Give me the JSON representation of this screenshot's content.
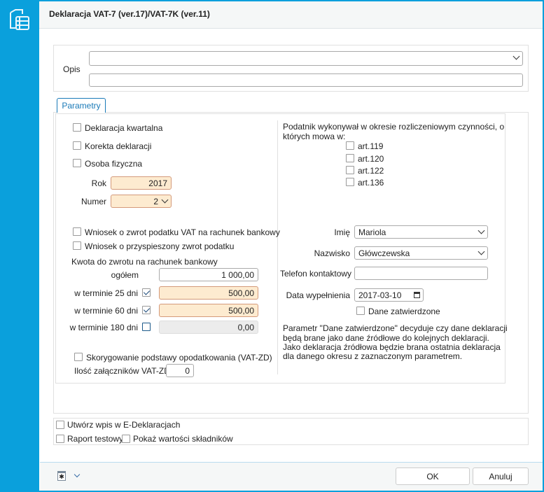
{
  "window": {
    "title": "Deklaracja VAT-7 (ver.17)/VAT-7K (ver.11)",
    "icon": "document-table-icon"
  },
  "opis": {
    "label": "Opis",
    "select_value": "",
    "text_value": ""
  },
  "tab": {
    "label": "Parametry"
  },
  "left": {
    "kwartalna": {
      "label": "Deklaracja kwartalna",
      "checked": false
    },
    "korekta": {
      "label": "Korekta deklaracji",
      "checked": false
    },
    "osoba": {
      "label": "Osoba fizyczna",
      "checked": false
    },
    "rok": {
      "label": "Rok",
      "value": "2017"
    },
    "numer": {
      "label": "Numer",
      "value": "2"
    },
    "wniosek_zwrot": {
      "label": "Wniosek o zwrot podatku VAT na rachunek bankowy",
      "checked": false
    },
    "wniosek_przysp": {
      "label": "Wniosek o przyspieszony zwrot podatku",
      "checked": false
    },
    "kwota_label": "Kwota do zwrotu na rachunek bankowy",
    "ogolem": {
      "label": "ogółem",
      "value": "1 000,00"
    },
    "t25": {
      "label": "w terminie 25 dni",
      "checked": true,
      "value": "500,00"
    },
    "t60": {
      "label": "w terminie 60 dni",
      "checked": true,
      "value": "500,00"
    },
    "t180": {
      "label": "w terminie 180 dni",
      "checked": false,
      "value": "0,00"
    },
    "skorygowanie": {
      "label": "Skorygowanie podstawy opodatkowania (VAT-ZD)",
      "checked": false
    },
    "ilosc": {
      "label": "Ilość załączników VAT-ZD",
      "value": "0"
    }
  },
  "right": {
    "podatnik_line1": "Podatnik wykonywał w okresie rozliczeniowym czynności, o",
    "podatnik_line2": "których mowa w:",
    "arts": [
      {
        "label": "art.119"
      },
      {
        "label": "art.120"
      },
      {
        "label": "art.122"
      },
      {
        "label": "art.136"
      }
    ],
    "imie": {
      "label": "Imię",
      "value": "Mariola"
    },
    "nazwisko": {
      "label": "Nazwisko",
      "value": "Główczewska"
    },
    "telefon": {
      "label": "Telefon kontaktowy",
      "value": ""
    },
    "data": {
      "label": "Data wypełnienia",
      "value": "2017-03-10"
    },
    "zatwierdzone": {
      "label": "Dane zatwierdzone",
      "checked": false
    },
    "note": [
      "Parametr \"Dane zatwierdzone\" decyduje czy dane deklaracji",
      "będą brane jako dane źródłowe do kolejnych deklaracji.",
      "Jako deklaracja źródłowa będzie brana ostatnia deklaracja",
      "dla danego okresu z zaznaczonym parametrem."
    ]
  },
  "bottom": {
    "utworz": "Utwórz wpis w E-Deklaracjach",
    "raport": "Raport testowy",
    "pokaz": "Pokaż wartości składników"
  },
  "footer": {
    "ok": "OK",
    "cancel": "Anuluj"
  },
  "colors": {
    "accent": "#0aa0dc",
    "required_bg": "#fdebd0",
    "tab_text": "#1a7ab8"
  }
}
